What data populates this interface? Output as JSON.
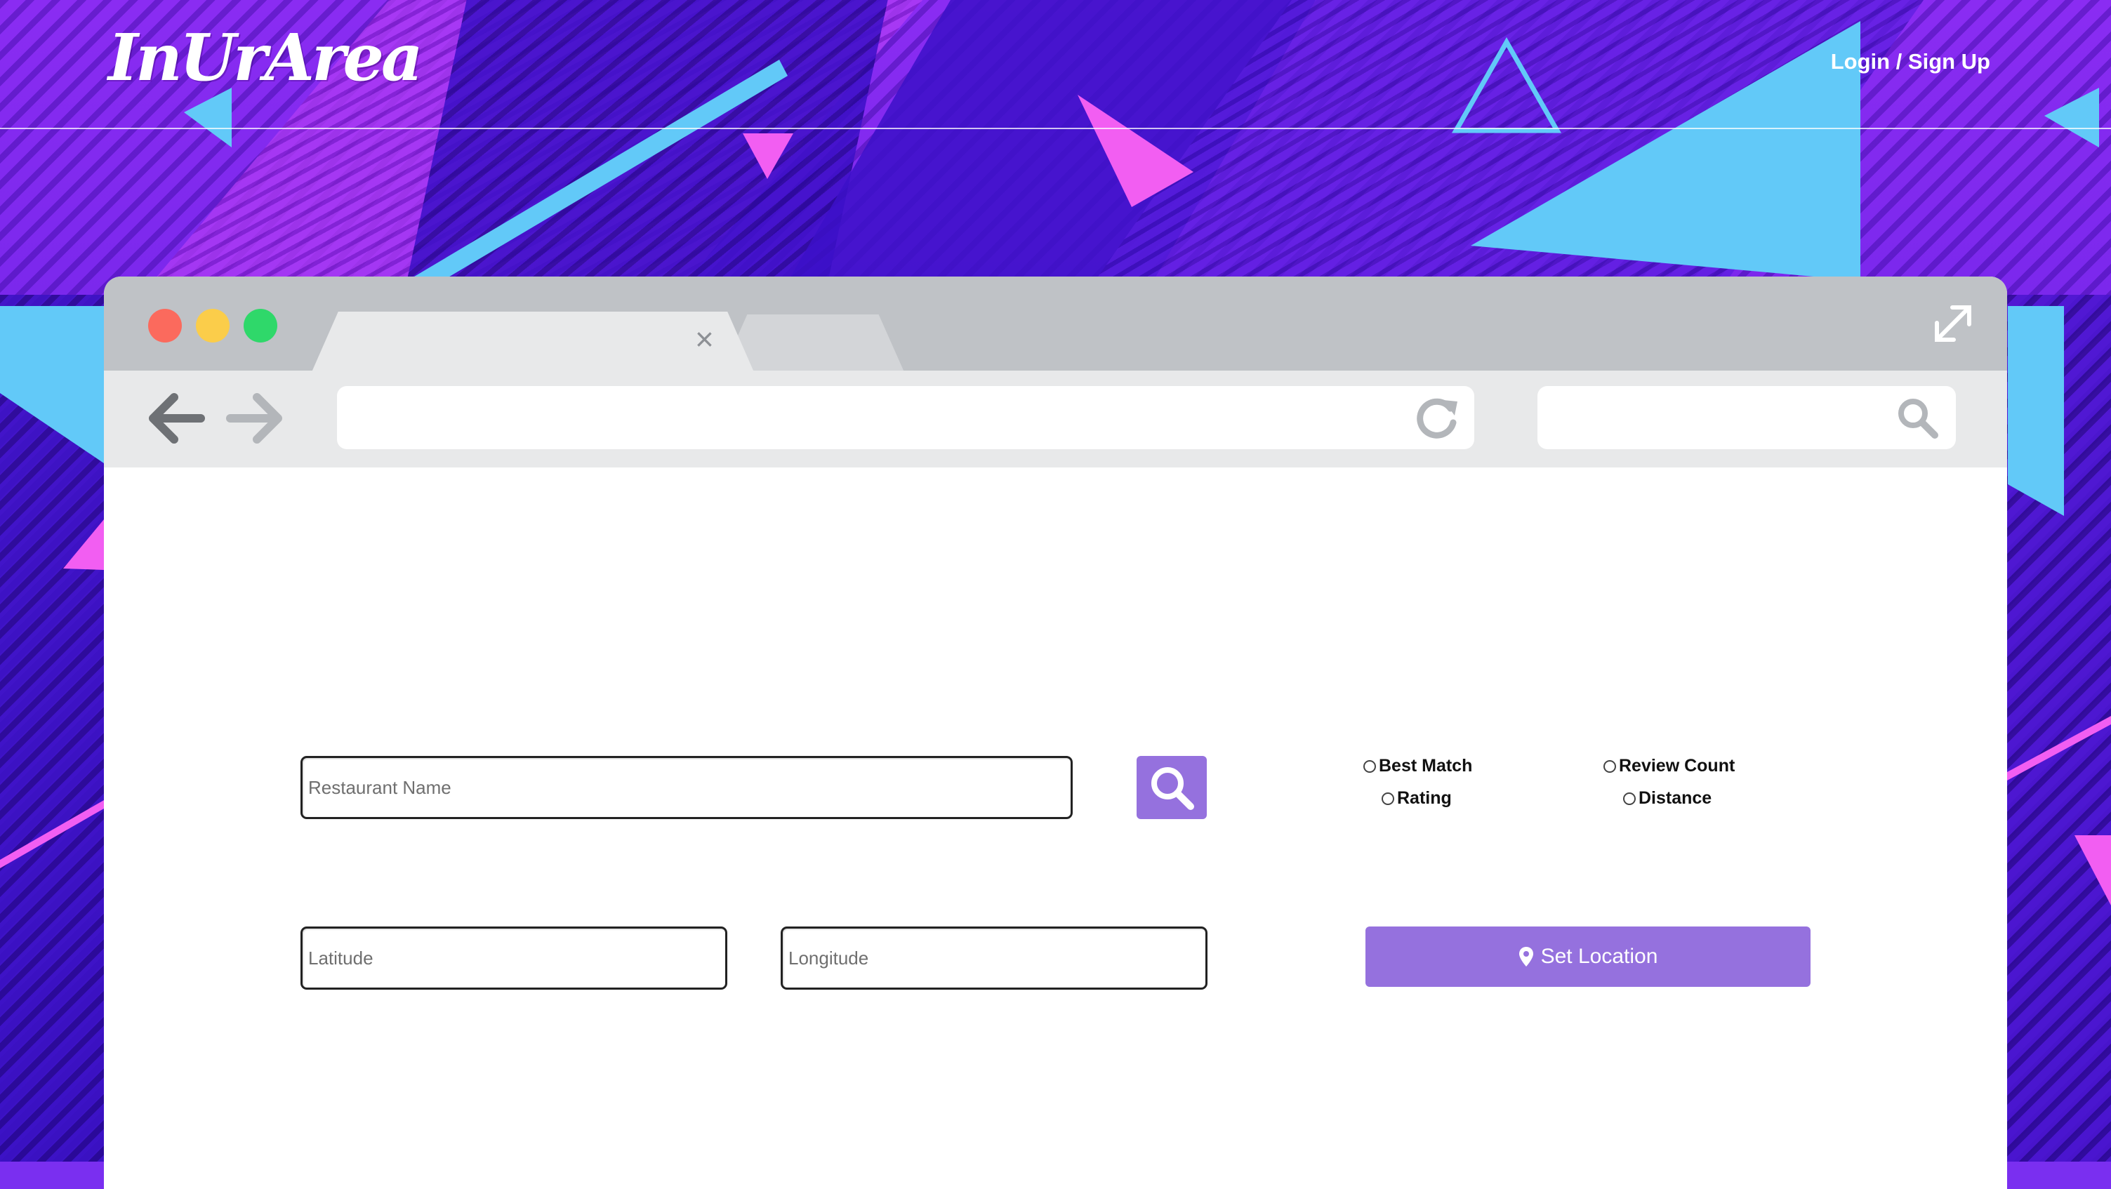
{
  "header": {
    "logo": "InUrArea",
    "login_link": "Login / Sign Up"
  },
  "browser_mockup": {
    "window_controls": [
      "close",
      "minimize",
      "maximize"
    ],
    "tab_close_glyph": "×",
    "icons": [
      "arrow-left-icon",
      "arrow-right-icon",
      "refresh-icon",
      "search-icon",
      "expand-icon"
    ]
  },
  "search": {
    "restaurant_placeholder": "Restaurant Name",
    "search_button_icon": "search-icon",
    "sort_options": [
      {
        "label": "Best Match",
        "selected": false
      },
      {
        "label": "Review Count",
        "selected": false
      },
      {
        "label": "Rating",
        "selected": false
      },
      {
        "label": "Distance",
        "selected": false
      }
    ]
  },
  "location": {
    "latitude_placeholder": "Latitude",
    "longitude_placeholder": "Longitude",
    "set_location_label": "Set Location",
    "set_location_icon": "map-marker-icon"
  },
  "colors": {
    "accent": "#9571de",
    "background_purple": "#7a2ff0",
    "background_blue": "#62c9f8",
    "background_pink": "#f25ef2",
    "browser_frame": "#bfc2c6",
    "browser_toolbar": "#e8e9ea"
  }
}
